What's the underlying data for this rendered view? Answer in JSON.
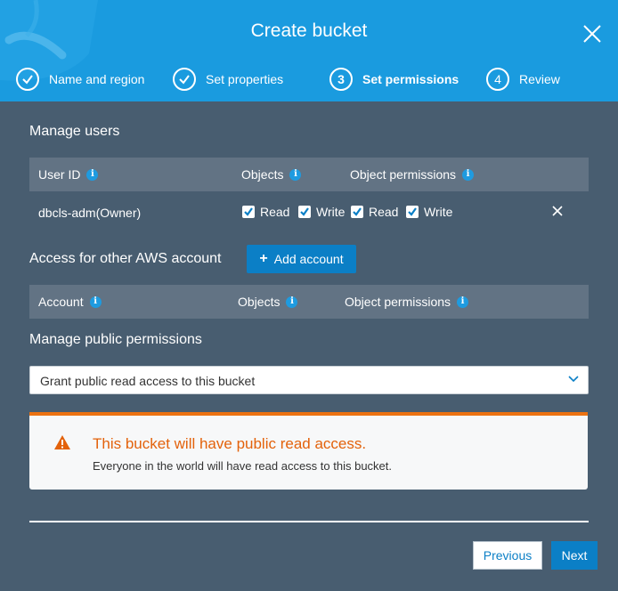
{
  "header": {
    "title": "Create bucket",
    "steps": [
      {
        "number": "",
        "label": "Name and region",
        "state": "complete"
      },
      {
        "number": "",
        "label": "Set properties",
        "state": "complete"
      },
      {
        "number": "3",
        "label": "Set permissions",
        "state": "active"
      },
      {
        "number": "4",
        "label": "Review",
        "state": "pending"
      }
    ]
  },
  "manage_users": {
    "title": "Manage users",
    "columns": {
      "user_id": "User ID",
      "objects": "Objects",
      "object_permissions": "Object permissions"
    },
    "rows": [
      {
        "user": "dbcls-adm(Owner)",
        "objects_read": "Read",
        "objects_write": "Write",
        "perm_read": "Read",
        "perm_write": "Write"
      }
    ]
  },
  "other_accounts": {
    "title": "Access for other AWS account",
    "add_button": "Add account",
    "columns": {
      "account": "Account",
      "objects": "Objects",
      "object_permissions": "Object permissions"
    }
  },
  "public_permissions": {
    "title": "Manage public permissions",
    "selected": "Grant public read access to this bucket"
  },
  "alert": {
    "title": "This bucket will have public read access.",
    "body": "Everyone in the world will have read access to this bucket."
  },
  "footer": {
    "previous": "Previous",
    "next": "Next"
  },
  "colors": {
    "header": "#1a9bdf",
    "body": "#485d70",
    "accent": "#0b7fc6",
    "warning": "#ec7211"
  }
}
